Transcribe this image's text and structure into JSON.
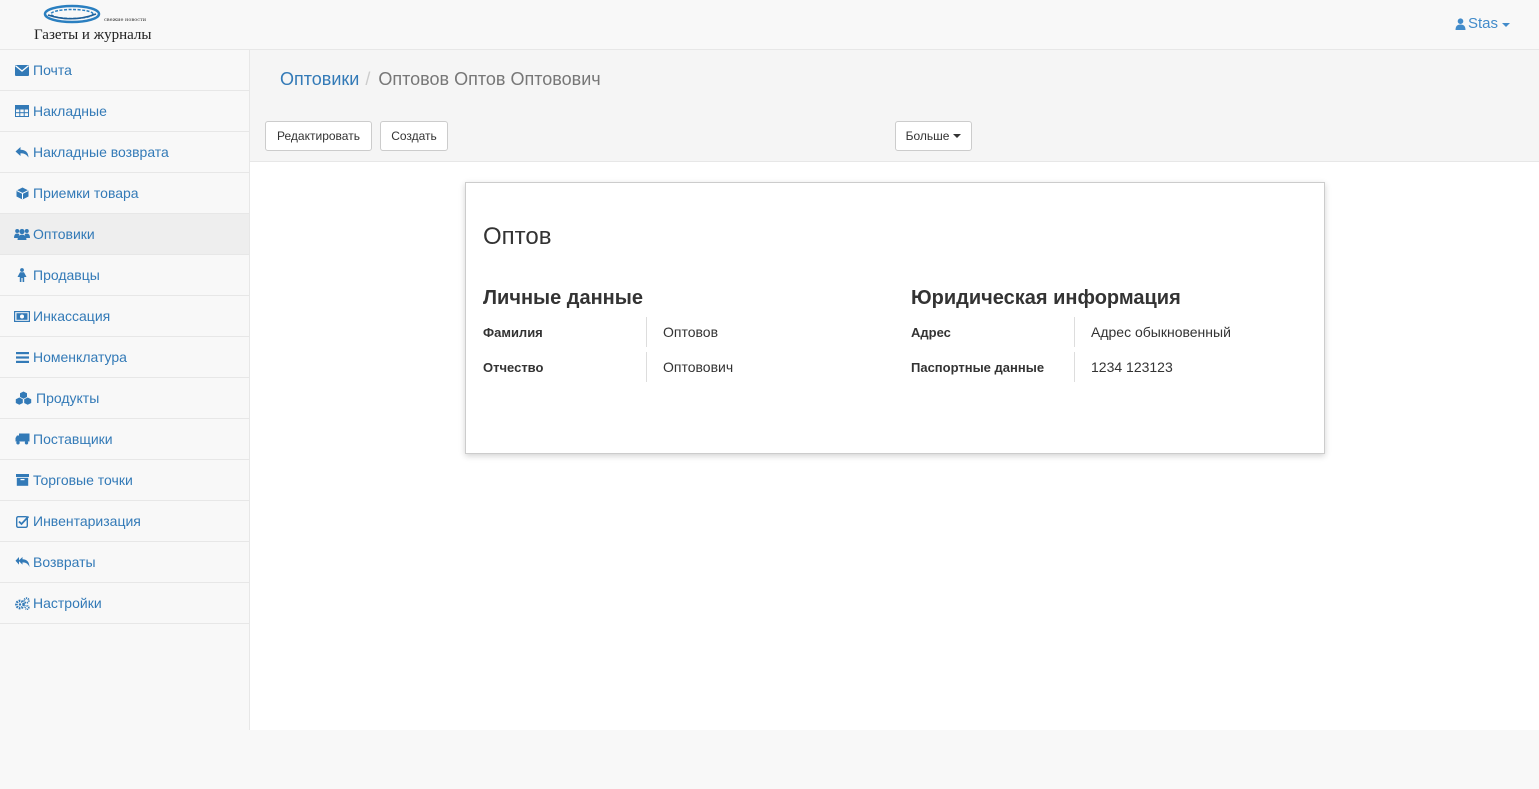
{
  "brand": {
    "name": "Газеты и журналы",
    "tagline": "свежие новости"
  },
  "user": {
    "name": "Stas",
    "icon": "user-icon"
  },
  "sidebar": {
    "items": [
      {
        "label": "Почта",
        "icon": "envelope-icon"
      },
      {
        "label": "Накладные",
        "icon": "table-icon"
      },
      {
        "label": "Накладные возврата",
        "icon": "reply-icon"
      },
      {
        "label": "Приемки товара",
        "icon": "cube-icon"
      },
      {
        "label": "Оптовики",
        "icon": "users-icon",
        "active": true
      },
      {
        "label": "Продавцы",
        "icon": "female-icon"
      },
      {
        "label": "Инкассация",
        "icon": "money-icon"
      },
      {
        "label": "Номенклатура",
        "icon": "bars-icon"
      },
      {
        "label": "Продукты",
        "icon": "cubes-icon"
      },
      {
        "label": "Поставщики",
        "icon": "truck-icon"
      },
      {
        "label": "Торговые точки",
        "icon": "archive-icon"
      },
      {
        "label": "Инвентаризация",
        "icon": "check-square-icon"
      },
      {
        "label": "Возвраты",
        "icon": "reply-all-icon"
      },
      {
        "label": "Настройки",
        "icon": "cogs-icon"
      }
    ]
  },
  "breadcrumb": {
    "parent": "Оптовики",
    "separator": "/",
    "current": "Оптовов Оптов Оптовович"
  },
  "toolbar": {
    "edit_label": "Редактировать",
    "create_label": "Создать",
    "more_label": "Больше"
  },
  "card": {
    "title": "Оптов",
    "personal": {
      "heading": "Личные данные",
      "fields": [
        {
          "label": "Фамилия",
          "value": "Оптовов"
        },
        {
          "label": "Отчество",
          "value": "Оптовович"
        }
      ]
    },
    "legal": {
      "heading": "Юридическая информация",
      "fields": [
        {
          "label": "Адрес",
          "value": "Адрес обыкновенный"
        },
        {
          "label": "Паспортные данные",
          "value": "1234 123123"
        }
      ]
    }
  },
  "colors": {
    "link": "#337ab7",
    "sidebar_bg": "#f8f8f8",
    "active_item_bg": "#eeeeee",
    "border": "#e7e7e7"
  }
}
